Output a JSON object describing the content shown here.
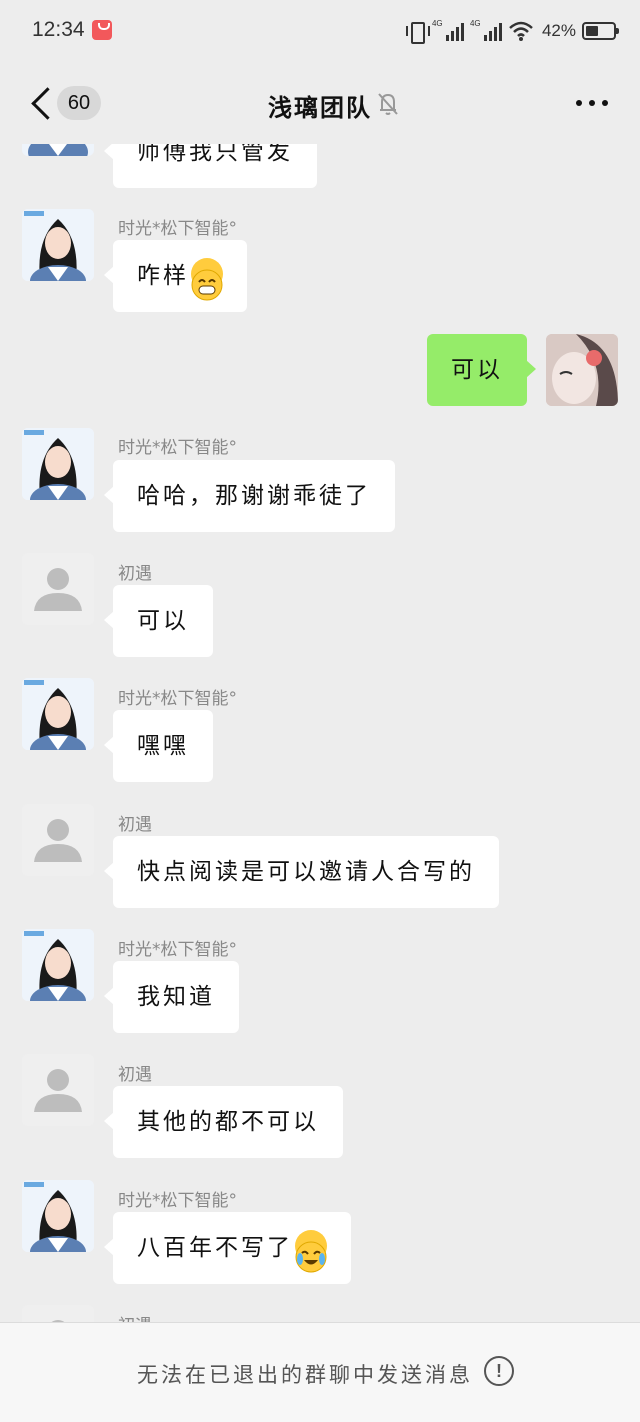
{
  "status_bar": {
    "time": "12:34",
    "signal_label_1": "4G",
    "signal_label_2": "4G",
    "battery_percent": "42%"
  },
  "navbar": {
    "unread_count": "60",
    "title": "浅璃团队"
  },
  "messages": [
    {
      "side": "in",
      "sender": "",
      "text": "师傅我只管发",
      "avatar": "girl"
    },
    {
      "side": "in",
      "sender": "时光*松下智能°",
      "text": "咋样",
      "emoji": "grinning-face",
      "avatar": "girl"
    },
    {
      "side": "out",
      "text": "可以",
      "avatar": "rose"
    },
    {
      "side": "in",
      "sender": "时光*松下智能°",
      "text": "哈哈，那谢谢乖徒了",
      "avatar": "girl"
    },
    {
      "side": "in",
      "sender": "初遇",
      "text": "可以",
      "avatar": "gray"
    },
    {
      "side": "in",
      "sender": "时光*松下智能°",
      "text": "嘿嘿",
      "avatar": "girl"
    },
    {
      "side": "in",
      "sender": "初遇",
      "text": "快点阅读是可以邀请人合写的",
      "avatar": "gray"
    },
    {
      "side": "in",
      "sender": "时光*松下智能°",
      "text": "我知道",
      "avatar": "girl"
    },
    {
      "side": "in",
      "sender": "初遇",
      "text": "其他的都不可以",
      "avatar": "gray"
    },
    {
      "side": "in",
      "sender": "时光*松下智能°",
      "text": "八百年不写了",
      "emoji": "crying-laughing-face",
      "avatar": "girl"
    },
    {
      "side": "in",
      "sender": "初遇",
      "text": "",
      "avatar": "gray"
    }
  ],
  "footer": {
    "notice": "无法在已退出的群聊中发送消息",
    "info_glyph": "!"
  }
}
